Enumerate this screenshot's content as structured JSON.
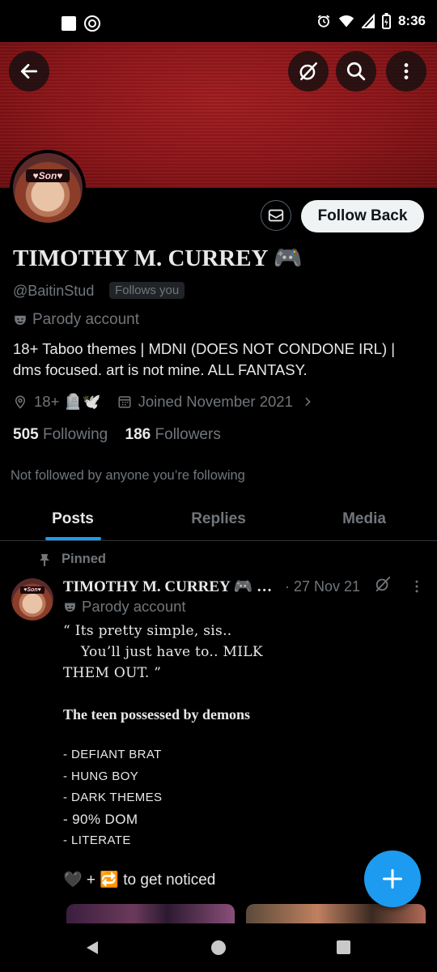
{
  "status_bar": {
    "time": "8:36",
    "battery_glyph": "⚡"
  },
  "banner": {
    "color": "#8a1417"
  },
  "profile": {
    "avatar_tag": "♥Son♥",
    "follow_back_label": "Follow Back",
    "display_name": "TIMOTHY M. CURREY 🎮",
    "handle": "@BaitinStud",
    "follows_you_label": "Follows you",
    "parody_label": "Parody account",
    "bio": "18+ Taboo themes | MDNI (DOES NOT CONDONE IRL) | dms focused. art is not mine. ALL FANTASY.",
    "location": "18+ 🪦🕊️",
    "joined": "Joined November 2021",
    "following_count": "505",
    "following_label": "Following",
    "followers_count": "186",
    "followers_label": "Followers",
    "not_followed_text": "Not followed by anyone you’re following"
  },
  "tabs": [
    {
      "label": "Posts",
      "active": true
    },
    {
      "label": "Replies",
      "active": false
    },
    {
      "label": "Media",
      "active": false
    }
  ],
  "pinned_post": {
    "pinned_label": "Pinned",
    "avatar_tag": "♥Son♥",
    "author_name": "TIMOTHY M. CURREY 🎮 …",
    "date": "· 27 Nov 21",
    "parody_label": "Parody account",
    "quote_line1": "“ Its pretty simple, sis..",
    "quote_line2": "You’ll just have to.. MILK",
    "quote_line3": "THEM OUT. ”",
    "subtitle": "The teen possessed by demons",
    "list_items": [
      "- DEFIANT BRAT",
      "- HUNG BOY",
      "- DARK THEMES",
      "- 90% DOM",
      "- LITERATE"
    ],
    "cta": "🖤 + 🔁 to get noticed"
  },
  "icons": [
    "back-arrow-icon",
    "grok-icon",
    "search-icon",
    "more-icon",
    "mail-icon",
    "location-icon",
    "calendar-icon",
    "chevron-right-icon",
    "pin-icon",
    "compose-plus-icon",
    "nav-back-icon",
    "nav-home-icon",
    "nav-recents-icon"
  ],
  "colors": {
    "accent": "#1d9bf0",
    "muted": "#71767b",
    "text": "#e7e9ea"
  }
}
